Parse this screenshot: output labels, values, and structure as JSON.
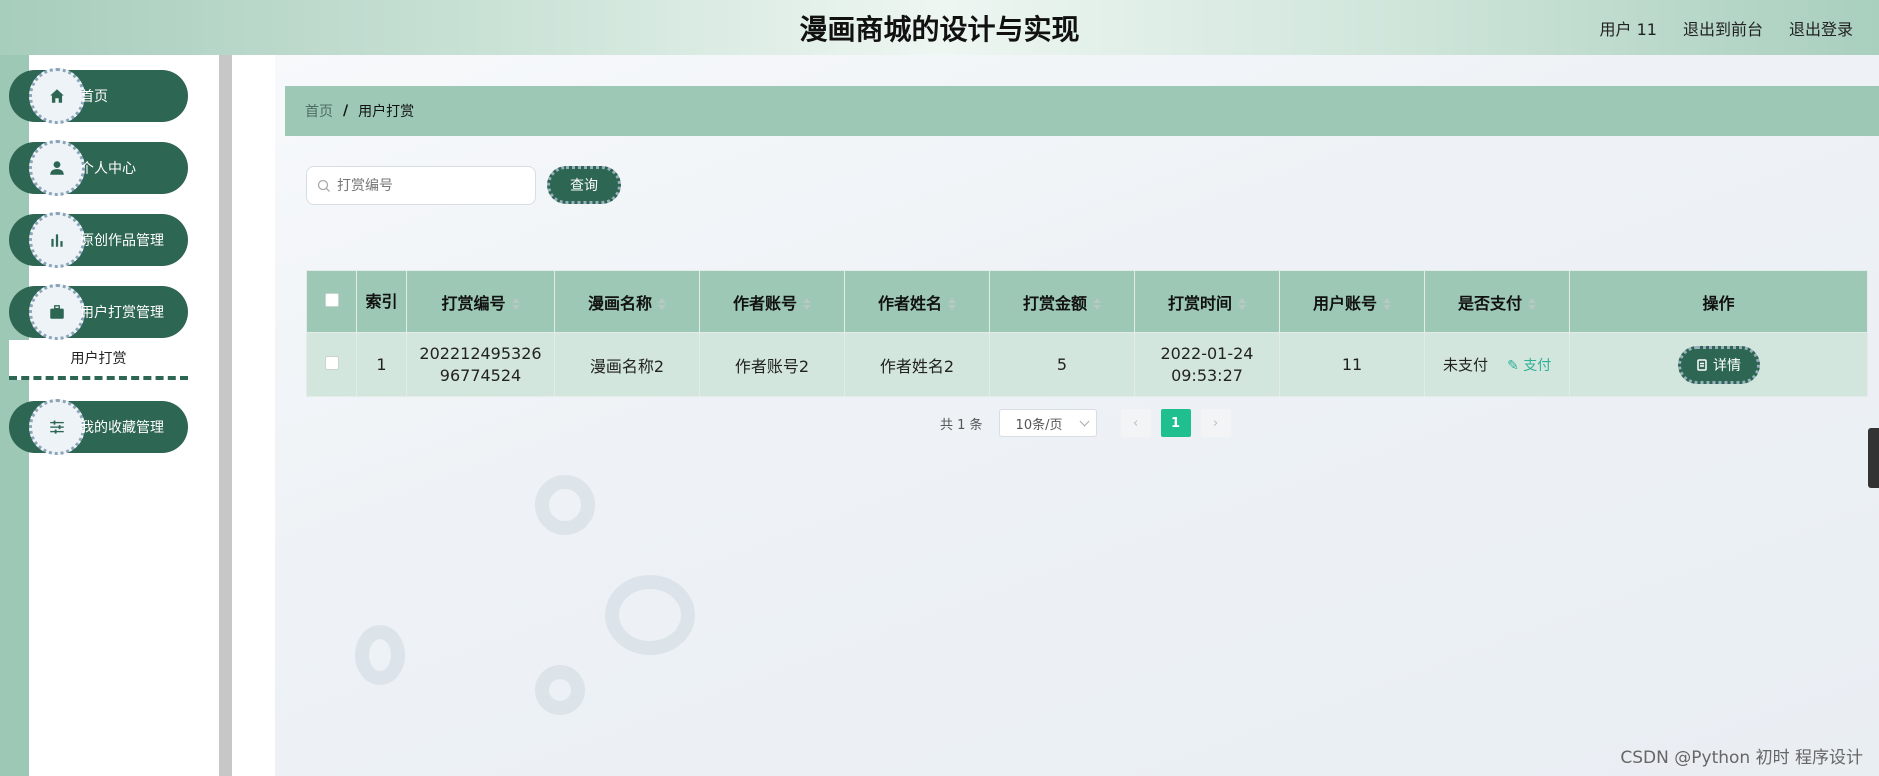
{
  "header": {
    "title": "漫画商城的设计与实现",
    "user_label": "用户 11",
    "to_front_label": "退出到前台",
    "logout_label": "退出登录"
  },
  "sidebar": {
    "items": [
      {
        "label": "首页",
        "icon": "home-icon"
      },
      {
        "label": "个人中心",
        "icon": "user-icon"
      },
      {
        "label": "原创作品管理",
        "icon": "bar-chart-icon"
      },
      {
        "label": "用户打赏管理",
        "icon": "briefcase-icon"
      },
      {
        "label": "我的收藏管理",
        "icon": "sliders-icon"
      }
    ],
    "submenu_label": "用户打赏"
  },
  "breadcrumb": {
    "home": "首页",
    "separator": "/",
    "current": "用户打赏"
  },
  "search": {
    "placeholder": "打赏编号",
    "button_label": "查询"
  },
  "table": {
    "headers": [
      "索引",
      "打赏编号",
      "漫画名称",
      "作者账号",
      "作者姓名",
      "打赏金额",
      "打赏时间",
      "用户账号",
      "是否支付",
      "操作"
    ],
    "rows": [
      {
        "index": "1",
        "reward_no": "20221249532696774524",
        "comic_name": "漫画名称2",
        "author_account": "作者账号2",
        "author_name": "作者姓名2",
        "amount": "5",
        "reward_time": "2022-01-24 09:53:27",
        "user_account": "11",
        "paid_status": "未支付",
        "pay_action": "支付",
        "detail_action": "详情"
      }
    ]
  },
  "pagination": {
    "total": "共 1 条",
    "page_size": "10条/页",
    "current_page": "1"
  },
  "watermark": "CSDN @Python 初时 程序设计",
  "colors": {
    "primary": "#2d6652",
    "accent": "#9cc8b5",
    "row_bg": "#d3e6dd",
    "page_active": "#1fbf8f"
  }
}
